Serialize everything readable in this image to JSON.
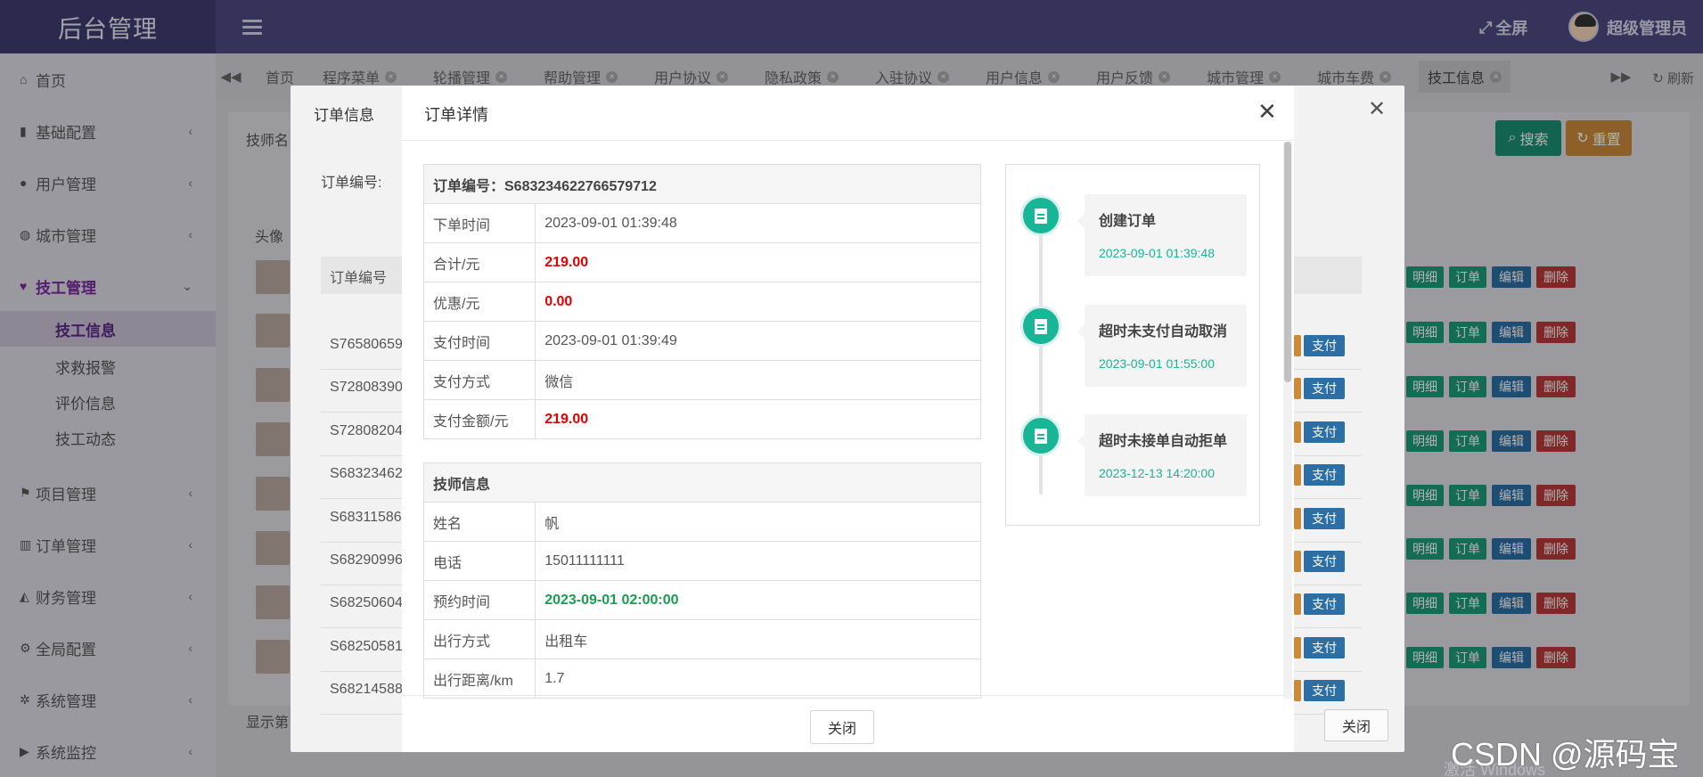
{
  "app": {
    "title": "后台管理",
    "fullscreen": "全屏",
    "user": "超级管理员",
    "refresh": "刷新"
  },
  "sidebar": {
    "items": [
      {
        "label": "首页",
        "icon": "home-icon"
      },
      {
        "label": "基础配置",
        "icon": "bookmark-icon"
      },
      {
        "label": "用户管理",
        "icon": "user-icon"
      },
      {
        "label": "城市管理",
        "icon": "globe-icon"
      },
      {
        "label": "技工管理",
        "icon": "heart-icon"
      },
      {
        "label": "项目管理",
        "icon": "flag-icon"
      },
      {
        "label": "订单管理",
        "icon": "bar-chart-icon"
      },
      {
        "label": "财务管理",
        "icon": "area-chart-icon"
      },
      {
        "label": "全局配置",
        "icon": "cogs-icon"
      },
      {
        "label": "系统管理",
        "icon": "gear-icon"
      },
      {
        "label": "系统监控",
        "icon": "video-icon"
      }
    ],
    "sub_items": [
      "技工信息",
      "求救报警",
      "评价信息",
      "技工动态"
    ]
  },
  "tabs": [
    "首页",
    "程序菜单",
    "轮播管理",
    "帮助管理",
    "用户协议",
    "隐私政策",
    "入驻协议",
    "用户信息",
    "用户反馈",
    "城市管理",
    "城市车费",
    "技工信息"
  ],
  "background": {
    "filter_label": "技师名",
    "search": "搜索",
    "reset": "重置",
    "col_avatar": "头像",
    "footer": "显示第",
    "row_buttons": {
      "detail": "明细",
      "order": "订单",
      "edit": "编辑",
      "delete": "删除",
      "pay": "支付"
    }
  },
  "modal_outer": {
    "title": "订单信息",
    "order_no_label": "订单编号:",
    "col_order_no": "订单编号",
    "close": "关闭",
    "rows": [
      "S76580659",
      "S72808390",
      "S72808204",
      "S68323462",
      "S68311586",
      "S68290996",
      "S68250604",
      "S68250581",
      "S68214588"
    ]
  },
  "modal": {
    "title": "订单详情",
    "close_button": "关闭",
    "order_header": "订单编号：S683234622766579712",
    "order_rows": [
      {
        "k": "下单时间",
        "v": "2023-09-01 01:39:48"
      },
      {
        "k": "合计/元",
        "v": "219.00"
      },
      {
        "k": "优惠/元",
        "v": "0.00"
      },
      {
        "k": "支付时间",
        "v": "2023-09-01 01:39:49"
      },
      {
        "k": "支付方式",
        "v": "微信"
      },
      {
        "k": "支付金额/元",
        "v": "219.00"
      }
    ],
    "tech_header": "技师信息",
    "tech_rows": [
      {
        "k": "姓名",
        "v": "帆"
      },
      {
        "k": "电话",
        "v": "15011111111"
      },
      {
        "k": "预约时间",
        "v": "2023-09-01 02:00:00"
      },
      {
        "k": "出行方式",
        "v": "出租车"
      },
      {
        "k": "出行距离/km",
        "v": "1.7"
      }
    ],
    "timeline": [
      {
        "title": "创建订单",
        "time": "2023-09-01 01:39:48"
      },
      {
        "title": "超时未支付自动取消",
        "time": "2023-09-01 01:55:00"
      },
      {
        "title": "超时未接单自动拒单",
        "time": "2023-12-13 14:20:00"
      }
    ]
  },
  "watermark": "CSDN @源码宝",
  "windows_watermark": "激活 Windows",
  "colors": {
    "topbar": "#4e4a83",
    "accent_green": "#18b596",
    "money_red": "#e30000",
    "time_green": "#1a9d50"
  }
}
